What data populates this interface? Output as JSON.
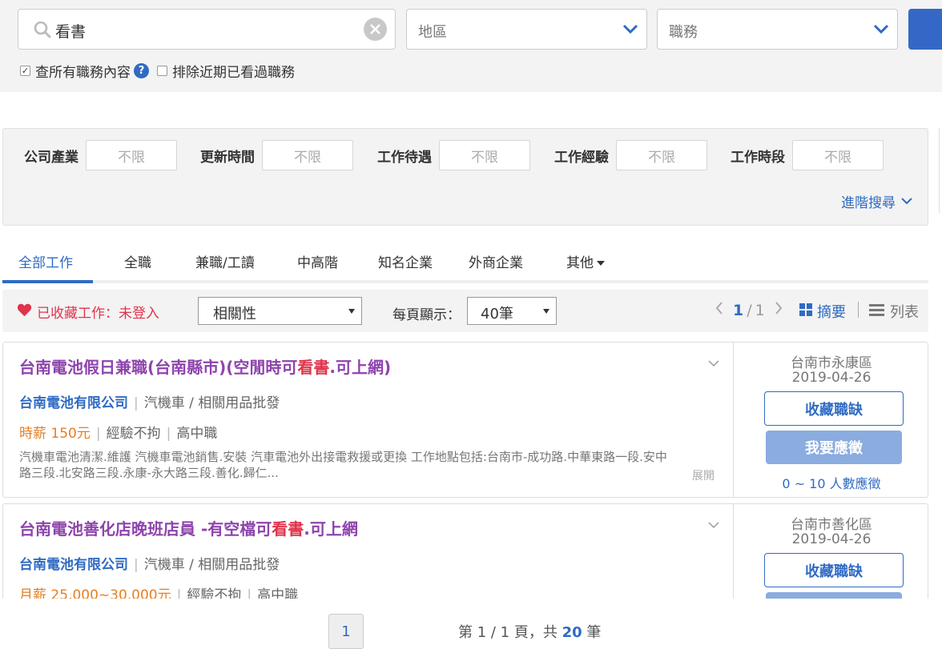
{
  "search": {
    "keyword": "看書",
    "area_label": "地區",
    "job_label": "職務"
  },
  "options": {
    "search_all": "查所有職務內容",
    "search_all_checked": true,
    "exclude_viewed": "排除近期已看過職務",
    "exclude_viewed_checked": false
  },
  "filters": [
    {
      "label": "公司產業",
      "value": "不限"
    },
    {
      "label": "更新時間",
      "value": "不限"
    },
    {
      "label": "工作待遇",
      "value": "不限"
    },
    {
      "label": "工作經驗",
      "value": "不限"
    },
    {
      "label": "工作時段",
      "value": "不限"
    }
  ],
  "advanced_search": "進階搜尋",
  "tabs": [
    "全部工作",
    "全職",
    "兼職/工讀",
    "中高階",
    "知名企業",
    "外商企業",
    "其他"
  ],
  "toolbar": {
    "favorites": "已收藏工作：未登入",
    "sort": "相關性",
    "per_page_label": "每頁顯示：",
    "per_page": "40筆",
    "page_current": "1",
    "page_sep": "/",
    "page_total": "1",
    "view_summary": "摘要",
    "view_list": "列表"
  },
  "jobs": [
    {
      "title_pre": "台南電池假日兼職(台南縣市)(空閒時可",
      "title_hl": "看書",
      "title_post": ".可上網)",
      "company": "台南電池有限公司",
      "industry": "汽機車 / 相關用品批發",
      "salary": "時薪 150元",
      "experience": "經驗不拘",
      "education": "高中職",
      "description": "汽機車電池清潔.維護 汽機車電池銷售.安裝 汽車電池外出接電救援或更換 工作地點包括:台南市-成功路.中華東路一段.安中路三段.北安路三段.永康-永大路三段.善化.歸仁...",
      "expand": "展開",
      "location": "台南市永康區",
      "date": "2019-04-26",
      "save": "收藏職缺",
      "apply": "我要應徵",
      "applicants": "0 ~ 10 人數應徵"
    },
    {
      "title_pre": "台南電池善化店晚班店員 -有空檔可",
      "title_hl": "看書",
      "title_post": ".可上網",
      "company": "台南電池有限公司",
      "industry": "汽機車 / 相關用品批發",
      "salary": "月薪 25,000~30,000元",
      "experience": "經驗不拘",
      "education": "高中職",
      "location": "台南市善化區",
      "date": "2019-04-26",
      "save": "收藏職缺"
    }
  ],
  "pagination": {
    "button": "1",
    "info_pre": "第 1 / 1 頁，共 ",
    "total": "20",
    "info_post": " 筆"
  },
  "colors": {
    "accent": "#2f6bc3",
    "title": "#8e44ad",
    "highlight": "#e0334c",
    "salary": "#e67e22"
  }
}
